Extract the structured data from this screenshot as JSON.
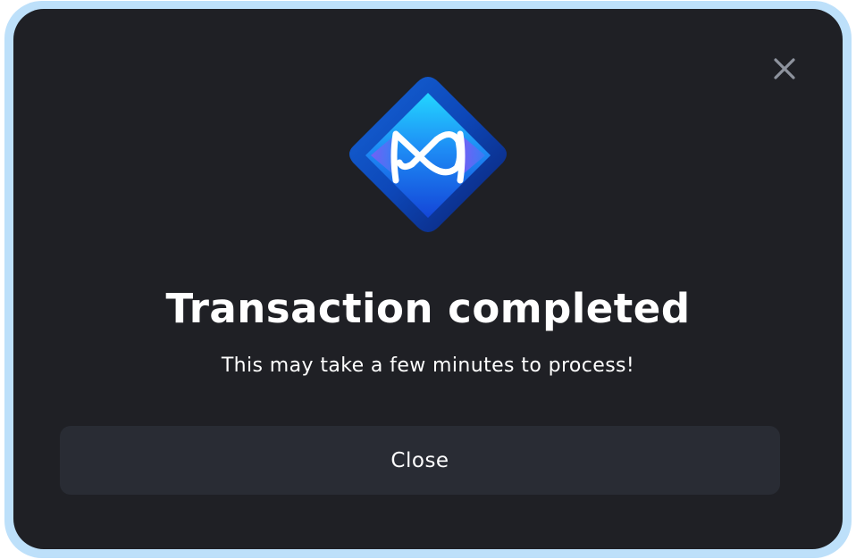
{
  "dialog": {
    "title": "Transaction completed",
    "message": "This may take a few minutes to process!",
    "close_button_label": "Close",
    "icons": {
      "close": "close-icon",
      "logo": "axie-infinity-logo-icon"
    }
  },
  "colors": {
    "frame_border": "#bde0fa",
    "dialog_background": "#1f2025",
    "button_background": "#292c34",
    "text": "#ffffff",
    "close_icon": "#8e939e"
  }
}
